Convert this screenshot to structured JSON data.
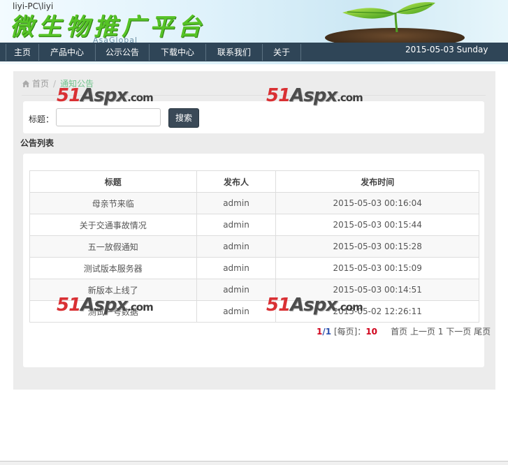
{
  "header": {
    "user": "liyi-PC\\liyi",
    "title": "微生物推广平台",
    "brand": "AsaGlobal",
    "date": "2015-05-03  Sunday"
  },
  "nav": {
    "items": [
      "主页",
      "产品中心",
      "公示公告",
      "下载中心",
      "联系我们",
      "关于"
    ]
  },
  "breadcrumb": {
    "home": "首页",
    "separator": "/",
    "current": "通知公告"
  },
  "search": {
    "label": "标题：",
    "value": "",
    "placeholder": "",
    "button": "搜索"
  },
  "list": {
    "title": "公告列表",
    "columns": [
      "标题",
      "发布人",
      "发布时间"
    ],
    "rows": [
      [
        "母亲节来临",
        "admin",
        "2015-05-03 00:16:04"
      ],
      [
        "关于交通事故情况",
        "admin",
        "2015-05-03 00:15:44"
      ],
      [
        "五一放假通知",
        "admin",
        "2015-05-03 00:15:28"
      ],
      [
        "测试版本服务器",
        "admin",
        "2015-05-03 00:15:09"
      ],
      [
        "新版本上线了",
        "admin",
        "2015-05-03 00:14:51"
      ],
      [
        "测试一号数据",
        "admin",
        "2015-05-02 12:26:11"
      ]
    ]
  },
  "pagination": {
    "current": "1",
    "slash": "/",
    "total": "1",
    "per_page_label": "[每页]：",
    "per_page": "10",
    "first": "首页",
    "prev": "上一页",
    "page_num": "1",
    "next": "下一页",
    "last": "尾页"
  },
  "watermark": {
    "num": "51",
    "word": "Aspx",
    "com": ".com"
  },
  "colors": {
    "nav_bg": "#2f4557",
    "title_green": "#56c327",
    "button_bg": "#3a4957",
    "page_red": "#d0021b",
    "page_blue": "#2d52b0",
    "breadcrumb_active": "#72c48d"
  }
}
